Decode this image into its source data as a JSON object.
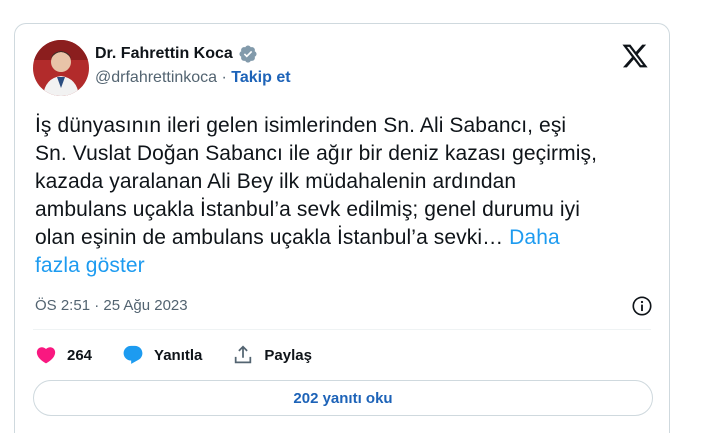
{
  "author": {
    "display_name": "Dr. Fahrettin Koca",
    "handle": "@drfahrettinkoca",
    "separator": " · ",
    "follow_label": "Takip et"
  },
  "tweet": {
    "lines": [
      "İş dünyasının ileri gelen isimlerinden Sn. Ali Sabancı, eşi",
      "Sn. Vuslat Doğan Sabancı ile ağır bir deniz kazası geçirmiş,",
      "kazada yaralanan Ali Bey ilk müdahalenin ardından",
      "ambulans uçakla İstanbul’a sevk edilmiş; genel durumu iyi",
      "olan eşinin de ambulans uçakla İstanbul’a sevki… "
    ],
    "show_more_part1": "Daha",
    "show_more_part2": "fazla göster",
    "timestamp": "ÖS 2:51 · 25 Ağu 2023"
  },
  "actions": {
    "like_count": "264",
    "reply_label": "Yanıtla",
    "share_label": "Paylaş"
  },
  "read_replies_label": "202 yanıtı oku",
  "colors": {
    "link": "#1d9bf0",
    "follow": "#1d63b8",
    "heart": "#f91880",
    "reply_bubble": "#1d9bf0",
    "verified": "#829aab"
  }
}
